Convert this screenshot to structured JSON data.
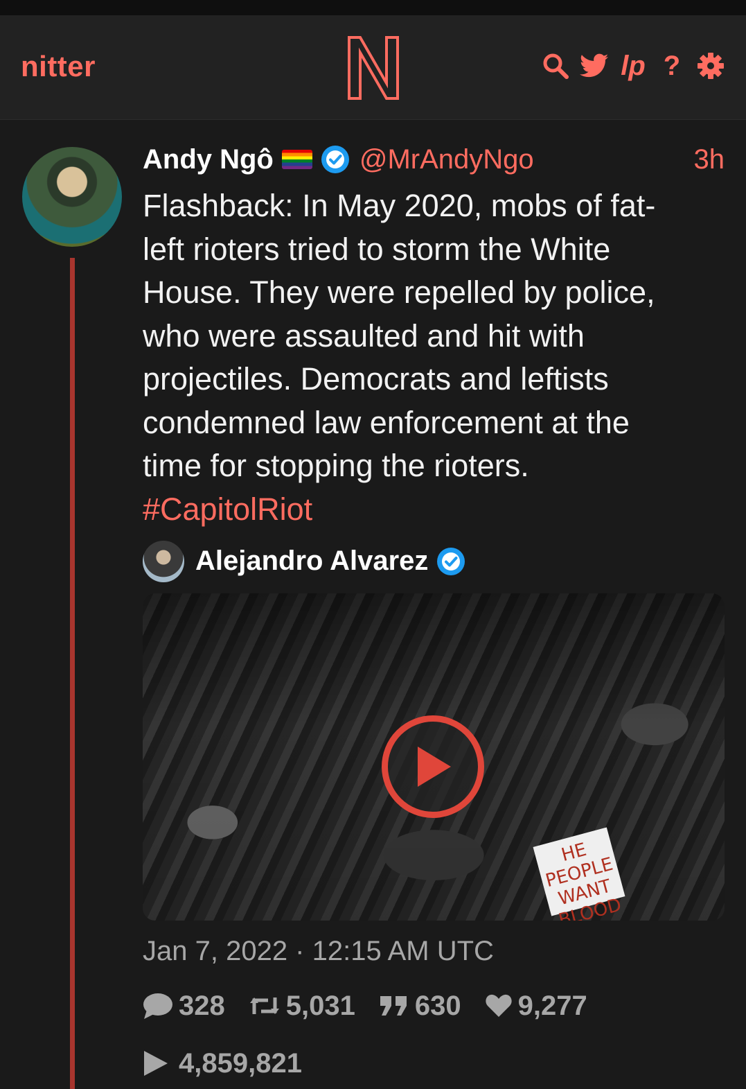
{
  "nav": {
    "brand": "nitter",
    "logo_letter": "N",
    "accent_color": "#ff6c60",
    "icons": [
      "search-icon",
      "twitter-bird-icon",
      "liberapay-icon",
      "help-icon",
      "settings-gear-icon"
    ],
    "liberapay_glyph": "lp",
    "help_glyph": "?"
  },
  "tweet": {
    "fullname": "Andy Ngô",
    "flag": "🏳️‍🌈",
    "verified": true,
    "username": "@MrAndyNgo",
    "time": "3h",
    "text": "Flashback: In May 2020, mobs of fat-\nleft rioters tried to storm the White\nHouse. They were repelled by police,\nwho were assaulted and hit with\nprojectiles. Democrats and leftists\ncondemned law enforcement at the\ntime for stopping the rioters.",
    "hashtag": "#CapitolRiot",
    "quote": {
      "name": "Alejandro Alvarez",
      "verified": true
    },
    "media": {
      "type": "video",
      "sign_text": "HE PEOPLE WANT BLOOD"
    },
    "date": "Jan 7, 2022 · 12:15 AM UTC",
    "stats": {
      "replies": "328",
      "retweets": "5,031",
      "quotes": "630",
      "likes": "9,277",
      "views": "4,859,821"
    }
  }
}
